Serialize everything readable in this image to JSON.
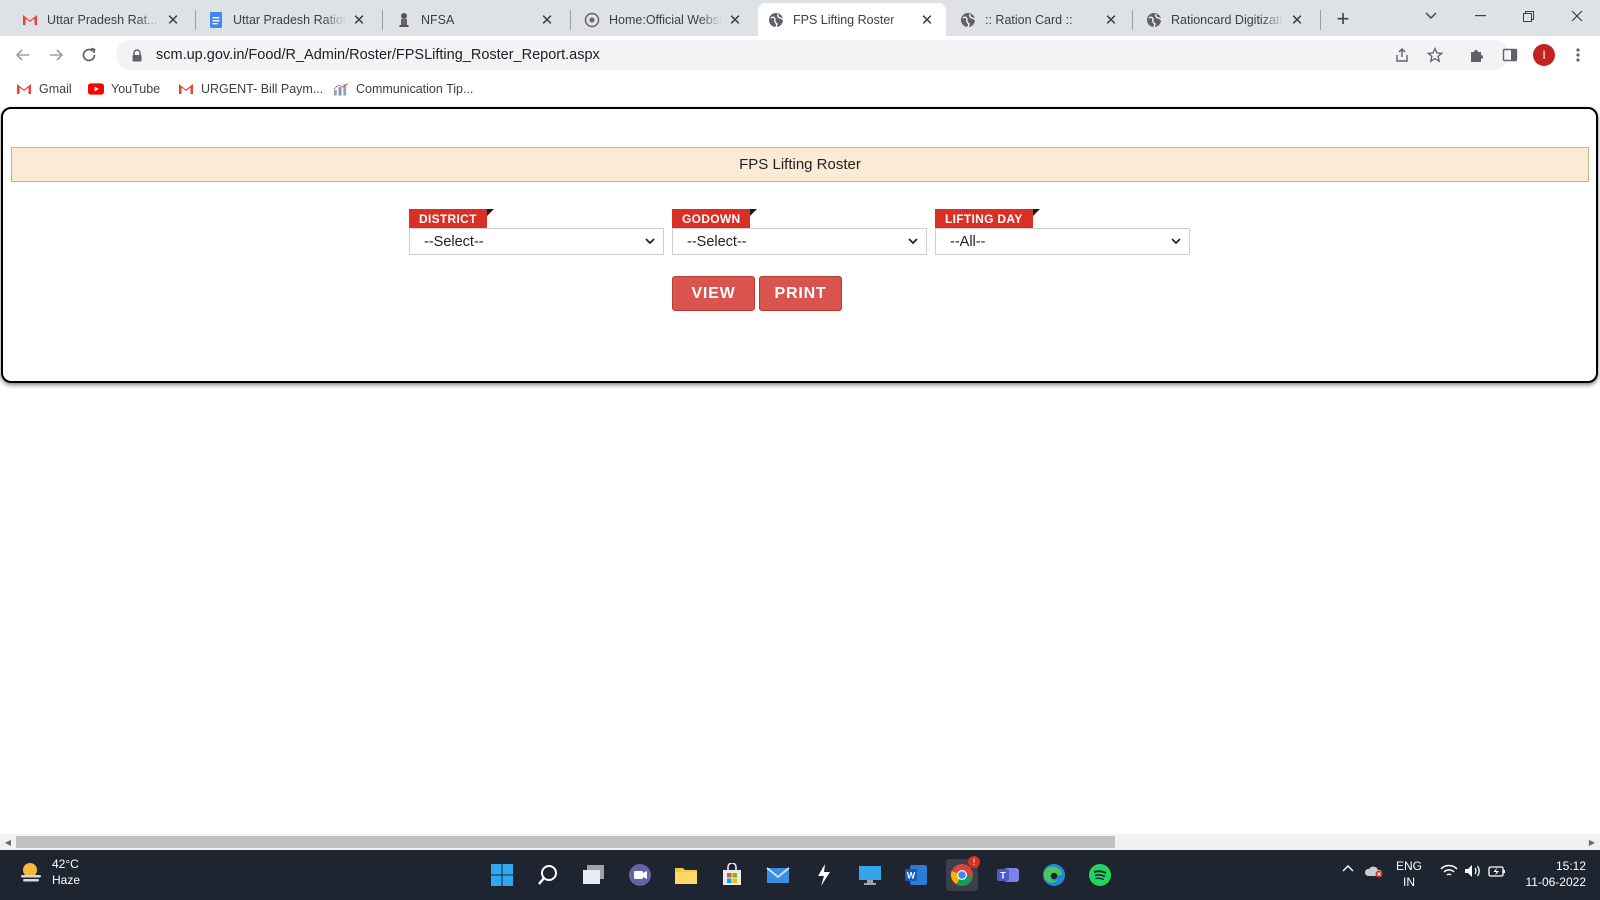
{
  "browser": {
    "tabs": [
      {
        "label": "Uttar Pradesh Rat... - ",
        "favicon": "gmail-icon"
      },
      {
        "label": "Uttar Pradesh Ration",
        "favicon": "docs-icon"
      },
      {
        "label": "NFSA",
        "favicon": "emblem-icon"
      },
      {
        "label": "Home:Official Website",
        "favicon": "website-icon"
      },
      {
        "label": "FPS Lifting Roster",
        "favicon": "globe-icon",
        "active": true
      },
      {
        "label": ":: Ration Card ::",
        "favicon": "globe-icon"
      },
      {
        "label": "Rationcard Digitization",
        "favicon": "globe-icon"
      }
    ],
    "address": "scm.up.gov.in/Food/R_Admin/Roster/FPSLifting_Roster_Report.aspx",
    "profile_initial": "I",
    "bookmarks": [
      {
        "label": "Gmail",
        "icon": "gmail-icon"
      },
      {
        "label": "YouTube",
        "icon": "youtube-icon"
      },
      {
        "label": "URGENT- Bill Paym...",
        "icon": "gmail-icon"
      },
      {
        "label": "Communication Tip...",
        "icon": "chart-icon"
      }
    ]
  },
  "page": {
    "title": "FPS Lifting Roster",
    "fields": [
      {
        "label": "DISTRICT",
        "value": "--Select--"
      },
      {
        "label": "GODOWN",
        "value": "--Select--"
      },
      {
        "label": "LIFTING DAY",
        "value": "--All--"
      }
    ],
    "buttons": {
      "view": "VIEW",
      "print": "PRINT"
    }
  },
  "taskbar": {
    "weather": {
      "temp": "42°C",
      "condition": "Haze"
    },
    "language": {
      "line1": "ENG",
      "line2": "IN"
    },
    "time": "15:12",
    "date": "11-06-2022",
    "chrome_badge": "!"
  },
  "colors": {
    "accent_red": "#d93025",
    "button_red": "#d9534f",
    "title_bar_bg": "#fbebd4",
    "taskbar_bg": "#1f2530"
  }
}
